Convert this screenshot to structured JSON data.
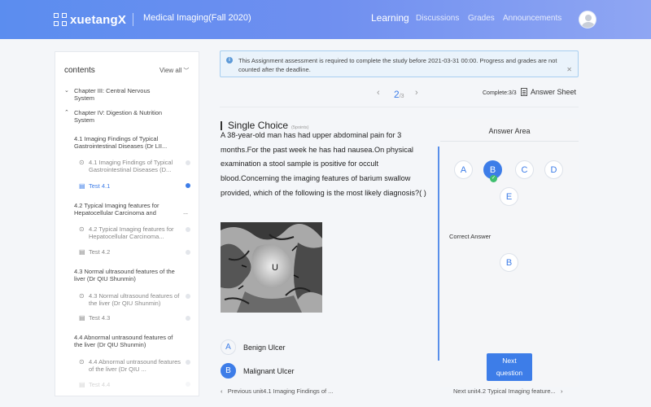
{
  "header": {
    "logo": "xuetangX",
    "course_title": "Medical Imaging(Fall 2020)",
    "nav": [
      "Learning",
      "Discussions",
      "Grades",
      "Announcements"
    ]
  },
  "sidebar": {
    "title": "contents",
    "view_all": "View all",
    "chapters": [
      "Chapter III: Central Nervous System",
      "Chapter IV: Digestion & Nutrition System"
    ],
    "sections": [
      {
        "title": "4.1 Imaging Findings of Typical Gastrointestinal Diseases (Dr LII...",
        "video": "4.1 Imaging Findings of Typical Gastrointestinal Diseases (D...",
        "test": "Test 4.1"
      },
      {
        "title": "4.2 Typical Imaging features for Hepatocellular Carcinoma and",
        "video": "4.2 Typical Imaging features for Hepatocellular Carcinoma...",
        "test": "Test 4.2"
      },
      {
        "title": "4.3 Normal ultrasound features of the liver (Dr QIU Shunmin)",
        "video": "4.3 Normal ultrasound features of the liver (Dr QIU Shunmin)",
        "test": "Test 4.3"
      },
      {
        "title": "4.4 Abnormal untrasound features of the liver (Dr QIU Shunmin)",
        "video": "4.4 Abnormal untrasound features of the liver (Dr QIU ...",
        "test": "Test 4.4"
      }
    ],
    "more": "..."
  },
  "notice": {
    "text": "This Assignment assessment is required to complete the study before 2021-03-31 00:00. Progress and grades are not counted after the deadline."
  },
  "pager": {
    "current": "2",
    "total": "/3",
    "complete": "Complete:3/3",
    "answer_sheet": "Answer Sheet"
  },
  "question": {
    "type": "Single Choice",
    "points": "(5points)",
    "text": "A 38-year-old man has had upper abdominal pain for 3 months.For the past week he has had nausea.On physical examination a stool sample is positive for occult blood.Concerning the imaging features of barium swallow provided, which of the following is the most likely diagnosis?( )",
    "image_label": "U",
    "options": [
      {
        "letter": "A",
        "text": "Benign Ulcer"
      },
      {
        "letter": "B",
        "text": "Malignant Ulcer"
      }
    ]
  },
  "answer_area": {
    "title": "Answer Area",
    "choices": [
      "A",
      "B",
      "C",
      "D",
      "E"
    ],
    "selected": "B",
    "correct_label": "Correct Answer",
    "correct": "B",
    "next_line1": "Next",
    "next_line2": "question"
  },
  "bottom_nav": {
    "prev": "Previous unit4.1 Imaging Findings of ...",
    "next": "Next unit4.2 Typical Imaging feature..."
  },
  "colors": {
    "accent": "#3d7de8",
    "header_start": "#5b8def",
    "header_end": "#8fa6f3",
    "correct_check": "#3fbf6e"
  }
}
